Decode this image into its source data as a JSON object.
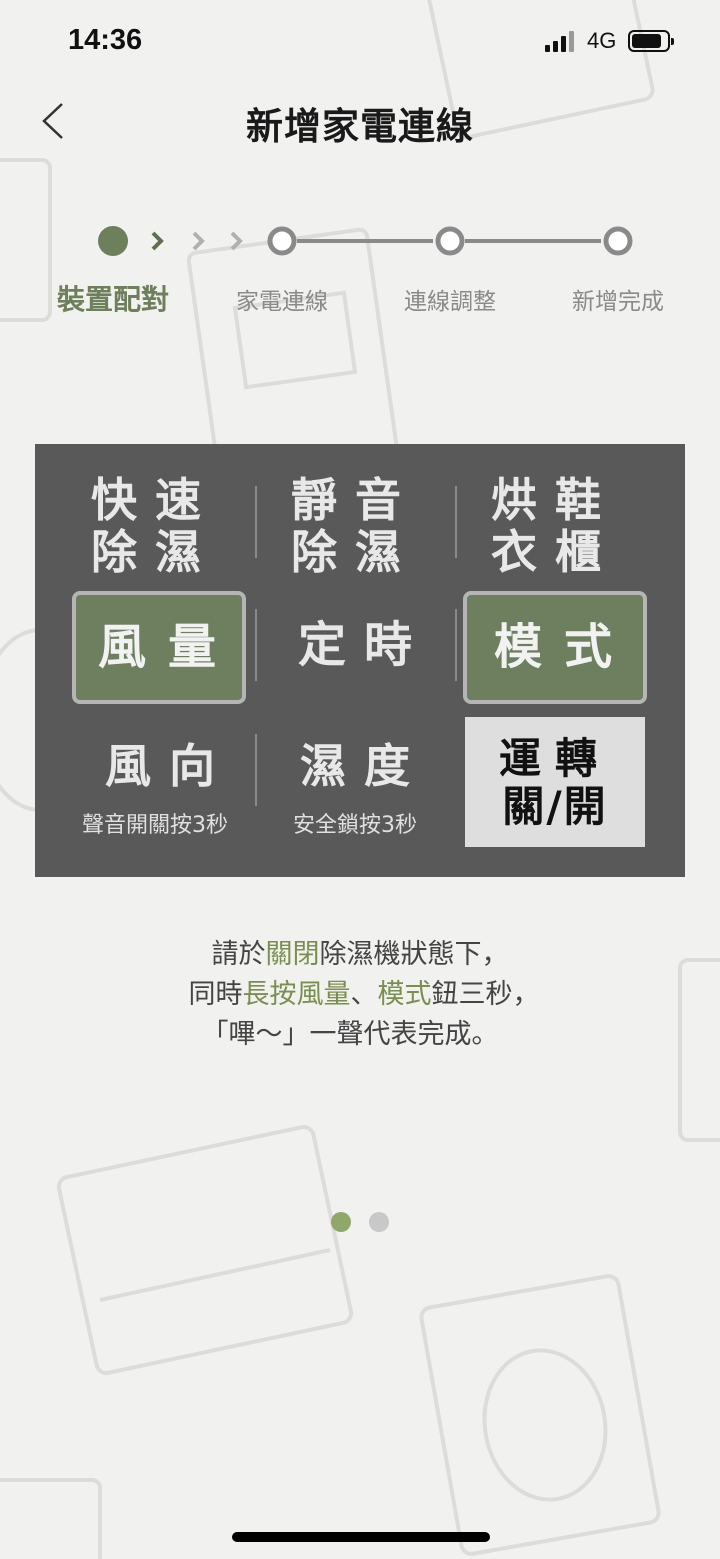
{
  "status_bar": {
    "time": "14:36",
    "network": "4G"
  },
  "header": {
    "title": "新增家電連線",
    "back_icon": "chevron-left-icon"
  },
  "stepper": {
    "steps": [
      {
        "label": "裝置配對",
        "state": "active"
      },
      {
        "label": "家電連線",
        "state": "pending"
      },
      {
        "label": "連線調整",
        "state": "pending"
      },
      {
        "label": "新增完成",
        "state": "pending"
      }
    ],
    "active_color": "#6e7f5c",
    "inactive_color": "#8a8a8a"
  },
  "panel": {
    "row1": {
      "left": "快速除濕",
      "middle": "靜音除濕",
      "right": "烘鞋衣櫃"
    },
    "left_top": "快速",
    "left_bottom": "除濕",
    "mid_top": "靜音",
    "mid_bottom": "除濕",
    "right_top": "烘鞋",
    "right_bottom": "衣櫃",
    "fan_button": "風量",
    "timer": "定時",
    "mode_button": "模式",
    "direction": "風向",
    "direction_sub": "聲音開關按3秒",
    "humidity": "濕度",
    "humidity_sub": "安全鎖按3秒",
    "power_top": "運轉",
    "power_bottom": "關/開",
    "highlight_color": "#6d7f5e"
  },
  "instruction": {
    "l1a": "請於",
    "l1b": "關閉",
    "l1c": "除濕機狀態下，",
    "l2a": "同時",
    "l2b": "長按風量",
    "l2c": "、",
    "l2d": "模式",
    "l2e": "鈕三秒，",
    "l3": "「嗶～」一聲代表完成。"
  },
  "pager": {
    "total": 2,
    "current": 1,
    "active_color": "#8fa86a",
    "inactive_color": "#c8c8c8"
  }
}
